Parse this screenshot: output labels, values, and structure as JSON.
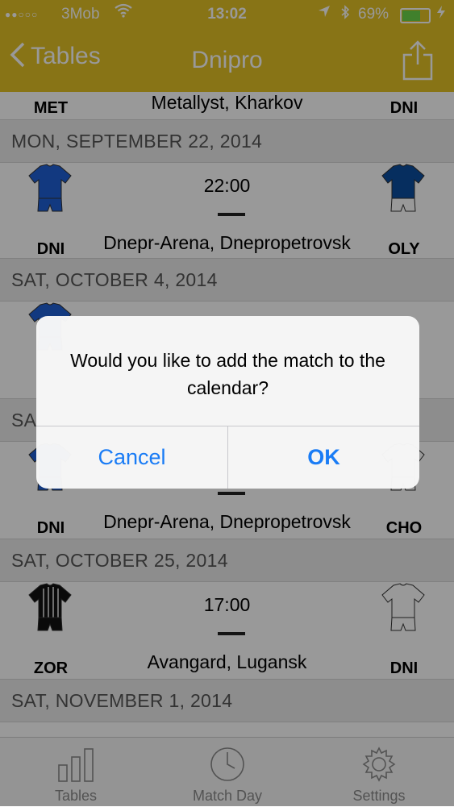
{
  "status_bar": {
    "signal": "●●○○○",
    "carrier": "3Mob",
    "time": "13:02",
    "battery_percent": "69%",
    "battery_level": 0.69
  },
  "nav": {
    "back_label": "Tables",
    "title": "Dnipro"
  },
  "matches": [
    {
      "home": "MET",
      "away": "DNI",
      "venue": "Metallyst, Kharkov",
      "home_kit": {
        "shirt": "#c81e2b",
        "shorts": "#1a2a7a"
      },
      "away_kit": {
        "shirt": "#ffffff",
        "shorts": "#ffffff"
      }
    },
    {
      "date": "MON, SEPTEMBER 22, 2014",
      "home": "DNI",
      "away": "OLY",
      "time": "22:00",
      "venue": "Dnepr-Arena, Dnepropetrovsk",
      "home_kit": {
        "shirt": "#1f5fd6",
        "shorts": "#1f5fd6"
      },
      "away_kit": {
        "shirt": "#0b4d9e",
        "shorts": "#ffffff"
      }
    },
    {
      "date": "SAT, OCTOBER 4, 2014",
      "home_kit": {
        "shirt": "#1f5fd6",
        "shorts": "#1f5fd6"
      }
    },
    {
      "date": "SA",
      "home": "DNI",
      "away": "CHO",
      "venue": "Dnepr-Arena, Dnepropetrovsk",
      "home_kit": {
        "shirt": "#1f5fd6",
        "shorts": "#1f5fd6"
      },
      "away_kit": {
        "shirt": "#ffffff",
        "shorts": "#ffffff"
      }
    },
    {
      "date": "SAT, OCTOBER 25, 2014",
      "home": "ZOR",
      "away": "DNI",
      "time": "17:00",
      "venue": "Avangard, Lugansk",
      "home_kit": {
        "shirt": "#111111",
        "shorts": "#111111"
      },
      "away_kit": {
        "shirt": "#ffffff",
        "shorts": "#ffffff"
      }
    },
    {
      "date": "SAT, NOVEMBER 1, 2014"
    }
  ],
  "alert": {
    "message": "Would you like to add the match to the calendar?",
    "cancel_label": "Cancel",
    "ok_label": "OK"
  },
  "tabs": [
    {
      "label": "Tables",
      "icon": "bar-chart-icon"
    },
    {
      "label": "Match Day",
      "icon": "clock-icon"
    },
    {
      "label": "Settings",
      "icon": "gear-icon"
    }
  ],
  "colors": {
    "nav_bar": "#e3c225",
    "alert_button": "#1a7cf5",
    "tab_inactive": "#8a8a8a"
  }
}
